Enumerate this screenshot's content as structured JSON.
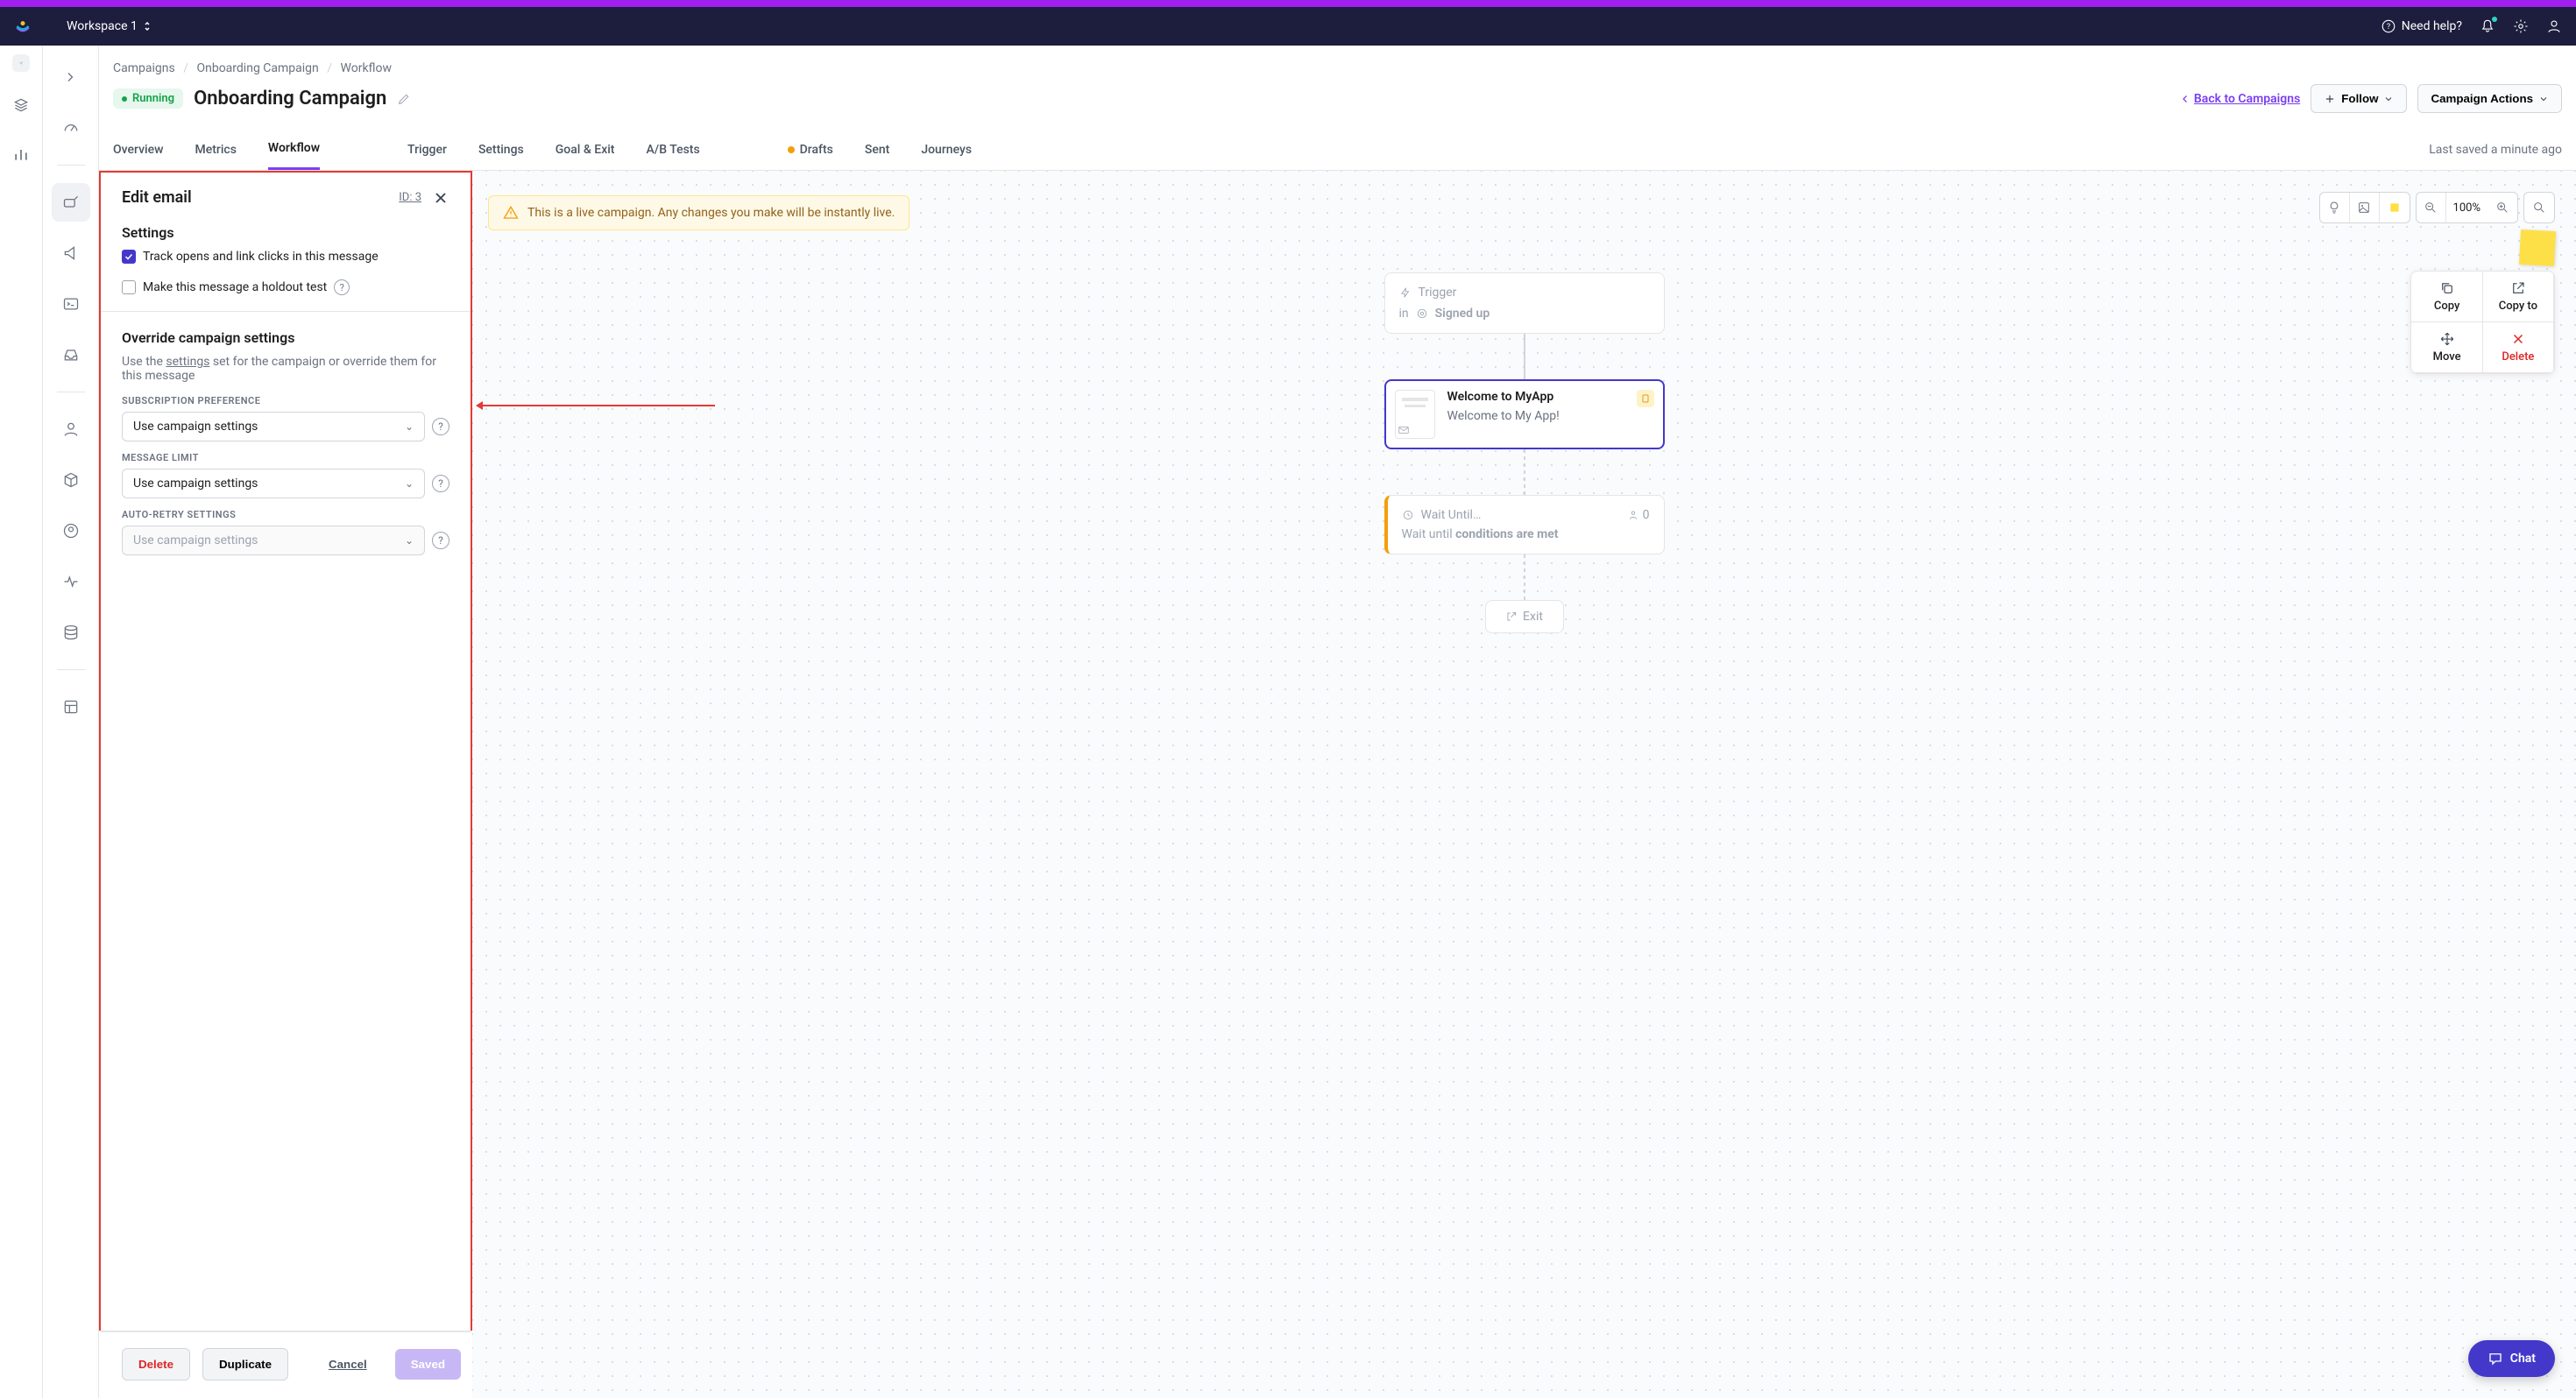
{
  "topbar": {
    "workspace_name": "Workspace 1",
    "help_label": "Need help?"
  },
  "breadcrumb": {
    "campaigns": "Campaigns",
    "campaign_name": "Onboarding Campaign",
    "current": "Workflow"
  },
  "header": {
    "status": "Running",
    "title": "Onboarding Campaign",
    "back_link": "Back to Campaigns",
    "follow_btn": "Follow",
    "actions_btn": "Campaign Actions"
  },
  "tabs": {
    "overview": "Overview",
    "metrics": "Metrics",
    "workflow": "Workflow",
    "trigger": "Trigger",
    "settings": "Settings",
    "goal_exit": "Goal & Exit",
    "ab_tests": "A/B Tests",
    "drafts": "Drafts",
    "sent": "Sent",
    "journeys": "Journeys",
    "last_saved": "Last saved a minute ago"
  },
  "panel": {
    "title": "Edit email",
    "id_label": "ID: 3",
    "settings_heading": "Settings",
    "track_label": "Track opens and link clicks in this message",
    "holdout_label": "Make this message a holdout test",
    "override_heading": "Override campaign settings",
    "override_desc_pre": "Use the ",
    "override_desc_link": "settings",
    "override_desc_post": " set for the campaign or override them for this message",
    "sub_pref_label": "SUBSCRIPTION PREFERENCE",
    "sub_pref_value": "Use campaign settings",
    "msg_limit_label": "MESSAGE LIMIT",
    "msg_limit_value": "Use campaign settings",
    "auto_retry_label": "AUTO-RETRY SETTINGS",
    "auto_retry_placeholder": "Use campaign settings",
    "footer": {
      "delete": "Delete",
      "duplicate": "Duplicate",
      "cancel": "Cancel",
      "saved": "Saved"
    }
  },
  "canvas": {
    "alert": "This is a live campaign. Any changes you make will be instantly live.",
    "zoom": "100%",
    "node_menu": {
      "copy": "Copy",
      "copy_to": "Copy to",
      "move": "Move",
      "delete": "Delete"
    },
    "trigger_node": {
      "label": "Trigger",
      "in": "in",
      "event": "Signed up"
    },
    "email_node": {
      "title": "Welcome to MyApp",
      "subject": "Welcome to My App!"
    },
    "wait_node": {
      "title": "Wait Until…",
      "count": "0",
      "desc_pre": "Wait until ",
      "desc_bold": "conditions are met"
    },
    "exit_node": "Exit"
  }
}
